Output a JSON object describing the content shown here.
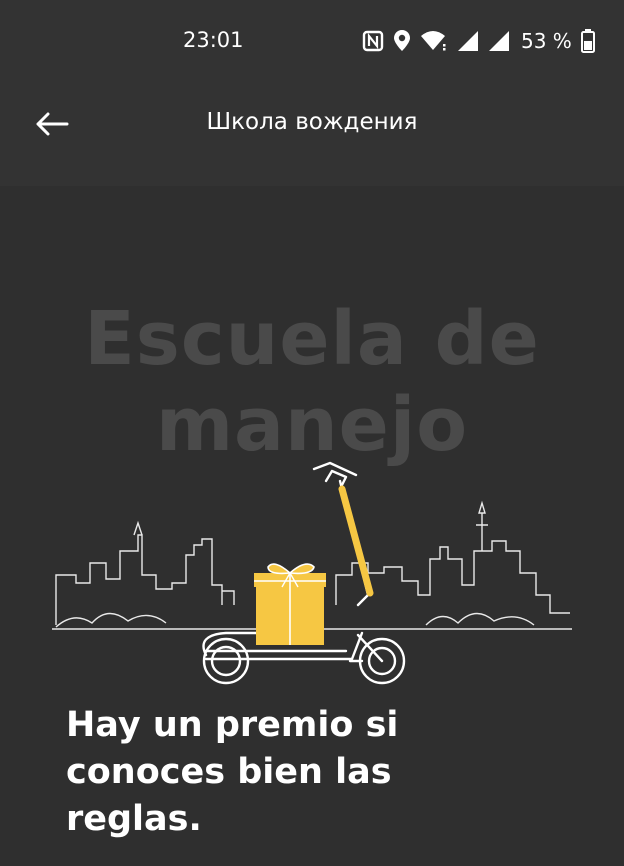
{
  "status_bar": {
    "time": "23:01",
    "battery_percent": "53 %",
    "icons": [
      "nfc-icon",
      "location-icon",
      "wifi-icon",
      "signal-icon",
      "signal-icon",
      "battery-icon"
    ]
  },
  "app_bar": {
    "title": "Школа вождения",
    "back_icon": "arrow-left-icon"
  },
  "hero": {
    "title_line1": "Escuela de",
    "title_line2": "manejo"
  },
  "headline": {
    "line1": "Hay un premio si",
    "line2": "conoces bien las",
    "line3": "reglas."
  },
  "colors": {
    "background": "#2f2f2f",
    "app_bar": "#333333",
    "accent_yellow": "#f6c743",
    "hero_text": "#4a4a4a"
  }
}
